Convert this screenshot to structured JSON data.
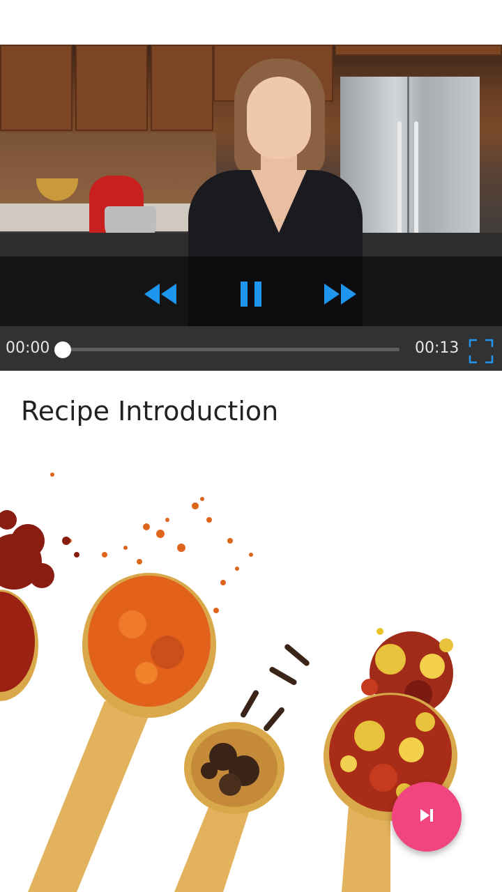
{
  "player": {
    "current_time": "00:00",
    "duration": "00:13",
    "progress": 0,
    "state": "playing",
    "icons": {
      "rewind": "rewind-icon",
      "pause": "pause-icon",
      "fast_forward": "fast-forward-icon",
      "fullscreen": "fullscreen-icon"
    },
    "accent_color": "#1e96f0"
  },
  "content": {
    "title": "Recipe Introduction"
  },
  "fab": {
    "icon": "skip-next-icon",
    "color": "#f0457f"
  }
}
